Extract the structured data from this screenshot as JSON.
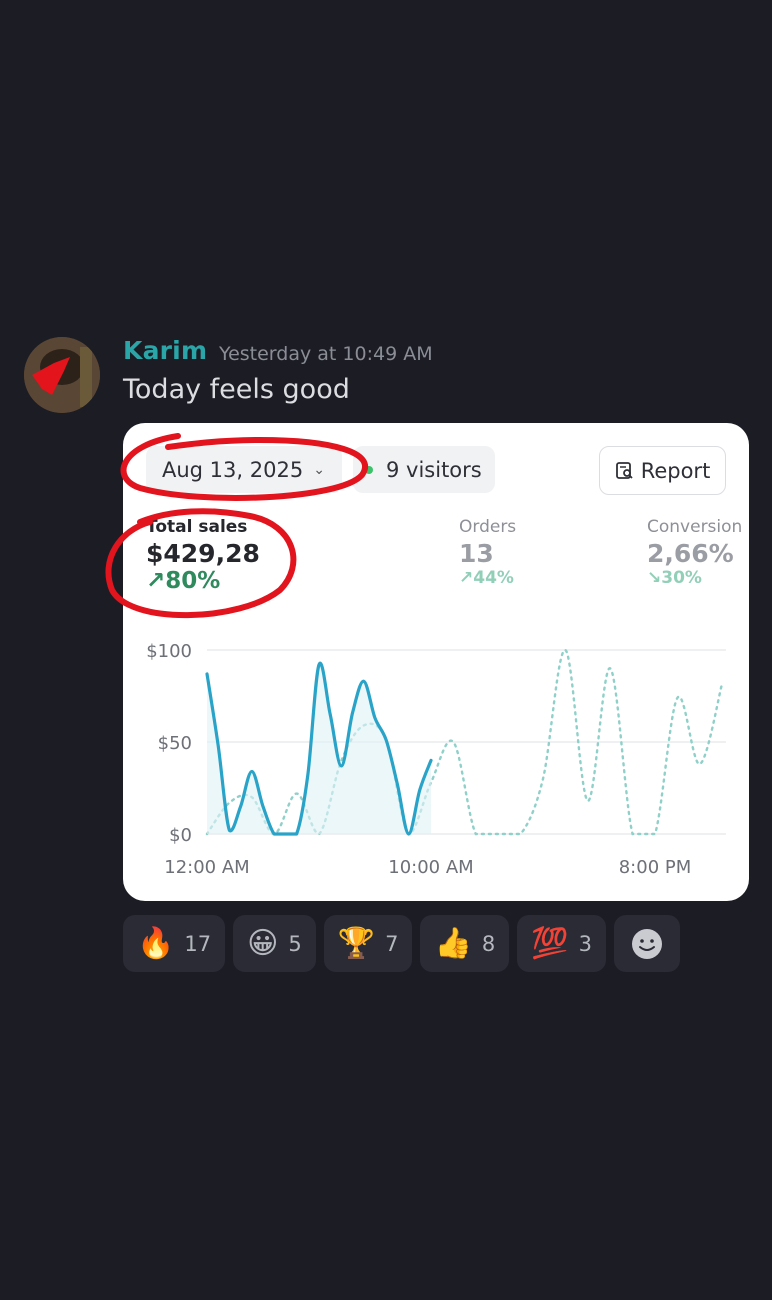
{
  "message": {
    "username": "Karim",
    "timestamp": "Yesterday at 10:49 AM",
    "text": "Today feels good"
  },
  "card": {
    "date": "Aug 13, 2025",
    "visitors": "9 visitors",
    "report_label": "Report",
    "metrics": [
      {
        "label": "Total sales",
        "value": "$429,28",
        "delta": "80%"
      },
      {
        "label": "Orders",
        "value": "13",
        "delta": "44%"
      },
      {
        "label": "Conversion",
        "value": "2,66%",
        "delta": "30%"
      }
    ]
  },
  "chart_data": {
    "type": "line",
    "y_ticks": [
      "$100",
      "$50",
      "$0"
    ],
    "ylim": [
      0,
      100
    ],
    "x_ticks": [
      "12:00 AM",
      "10:00 AM",
      "8:00 PM"
    ],
    "grid": true,
    "colors": {
      "today": "#2aa3c8",
      "comparison": "#8fd0c8"
    },
    "series": [
      {
        "style": "solid",
        "x": [
          0,
          0.5,
          1,
          1.5,
          2,
          2.5,
          3,
          3.5,
          4,
          4.5,
          5,
          5.5,
          6,
          6.5,
          7,
          7.5,
          8,
          8.5,
          9,
          9.5,
          10
        ],
        "values": [
          87,
          48,
          2,
          15,
          34,
          15,
          0,
          0,
          0,
          32,
          92,
          65,
          37,
          66,
          83,
          63,
          51,
          27,
          0,
          24,
          40
        ]
      },
      {
        "style": "dotted",
        "x": [
          0,
          1,
          2,
          3,
          4,
          5,
          6,
          7,
          8,
          9,
          10,
          11,
          12,
          13,
          14,
          15,
          16,
          17,
          18,
          19,
          20,
          21,
          22,
          23
        ],
        "values": [
          0,
          17,
          20,
          0,
          22,
          0,
          40,
          59,
          51,
          0,
          28,
          50,
          0,
          0,
          0,
          30,
          100,
          18,
          90,
          0,
          0,
          74,
          38,
          82
        ]
      }
    ]
  },
  "reactions": [
    {
      "emoji": "🔥",
      "count": "17"
    },
    {
      "emoji": "😀",
      "count": "5"
    },
    {
      "emoji": "🏆",
      "count": "7"
    },
    {
      "emoji": "👍",
      "count": "8"
    },
    {
      "emoji": "💯",
      "count": "3"
    }
  ],
  "icons": [
    "chevron-down-icon",
    "status-dot-icon",
    "report-icon",
    "trend-up-icon",
    "add-reaction-icon"
  ]
}
